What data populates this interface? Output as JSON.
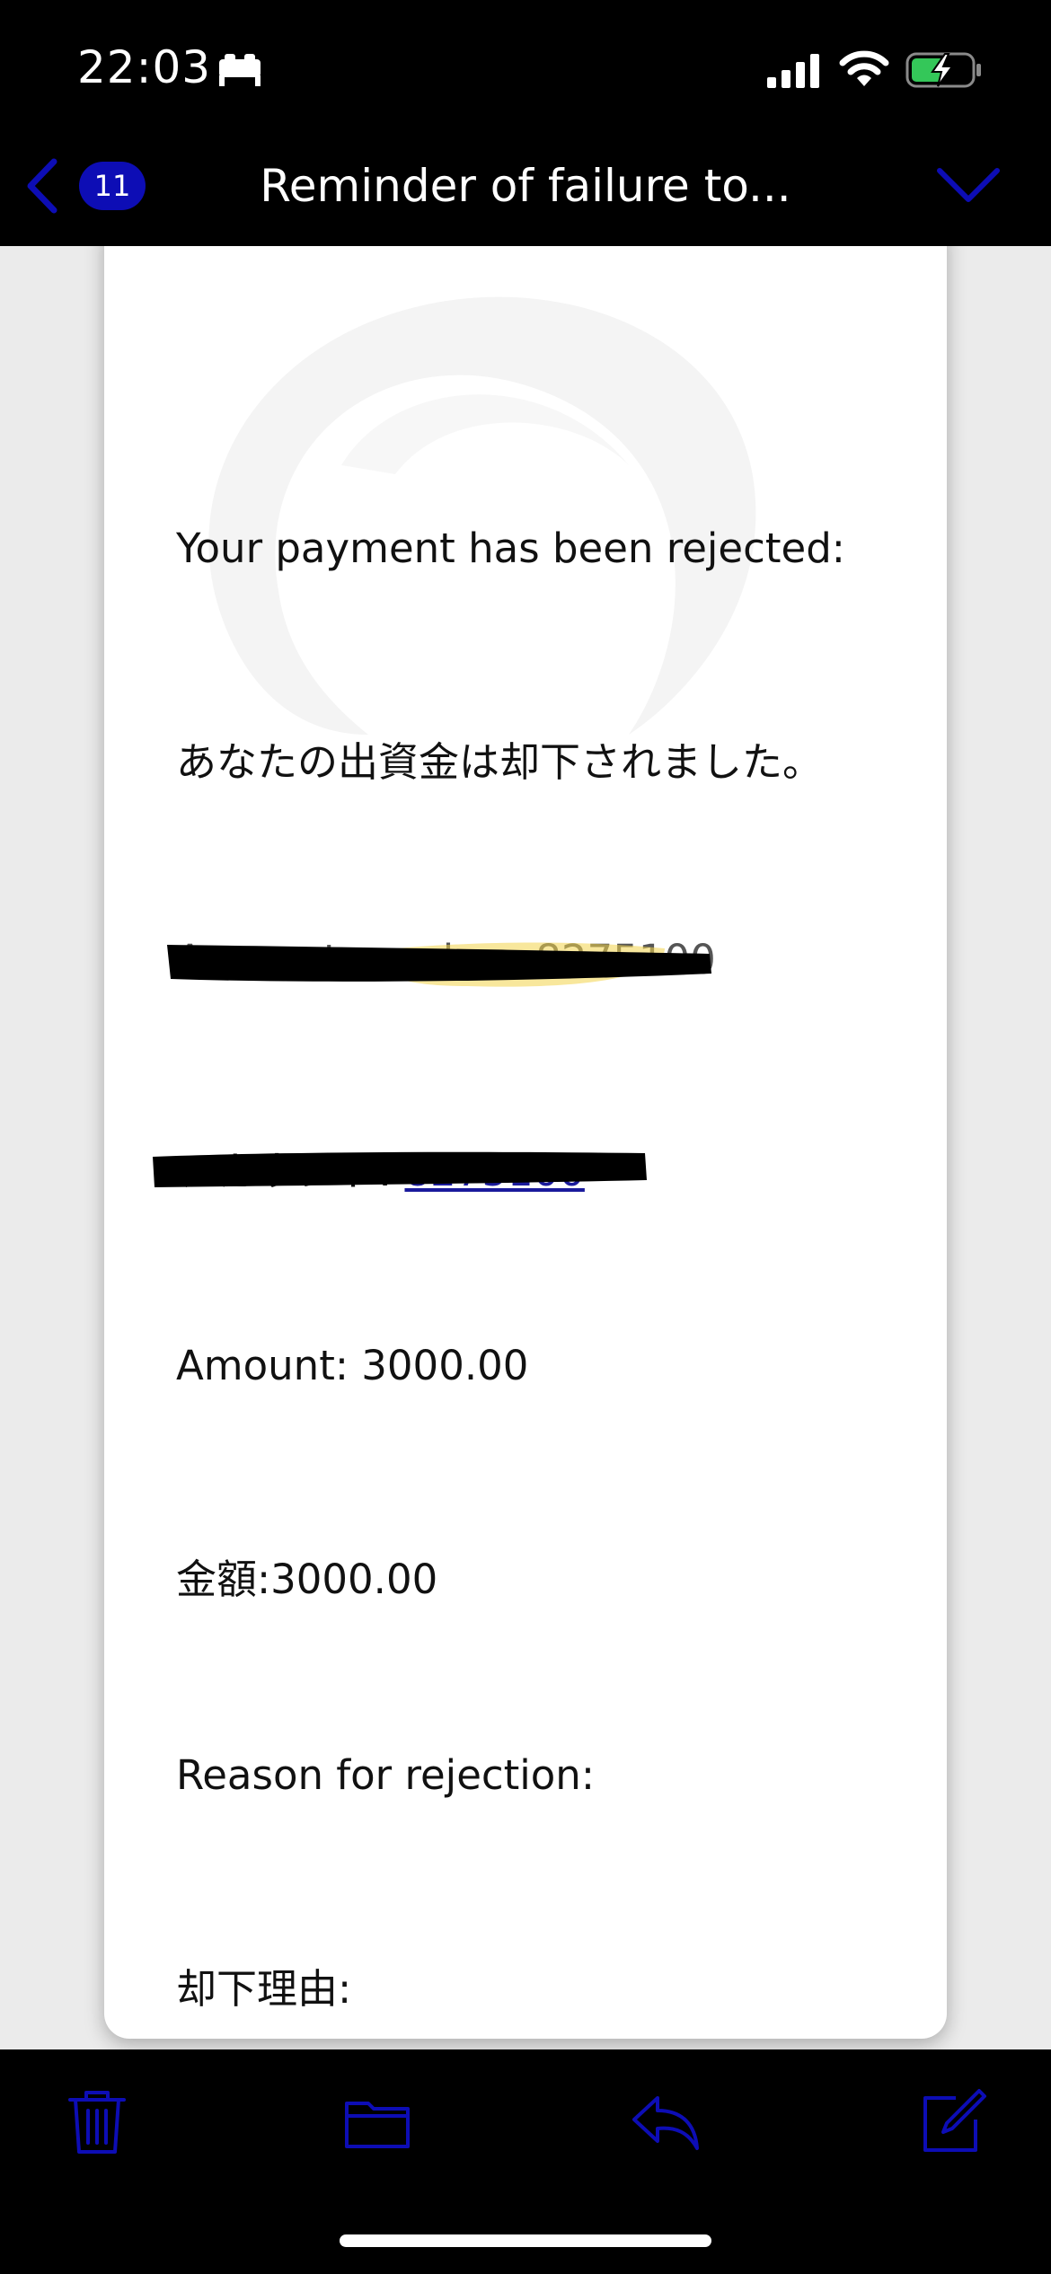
{
  "status_bar": {
    "time": "22:03",
    "icons": [
      "sleep-focus-icon",
      "cellular-signal-icon",
      "wifi-icon",
      "battery-charging-icon"
    ]
  },
  "nav": {
    "back_icon": "chevron-left-icon",
    "unread_count": "11",
    "title": "Reminder of failure to...",
    "next_icon": "chevron-down-icon"
  },
  "mail": {
    "line_rejected_en": "Your payment has been rejected:",
    "line_rejected_ja": "あなたの出資金は却下されました。",
    "line_account_en": "Account number: 8275100",
    "line_account_ja_label": "アカウント: ",
    "line_account_ja_link": "8275100",
    "line_amount_en": "Amount: 3000.00",
    "line_amount_ja": "金額:3000.00",
    "line_reason_en": "Reason for rejection:",
    "line_reason_ja": "却下理由:",
    "missing_image_glyph": "?"
  },
  "toolbar": {
    "icons": [
      "trash-icon",
      "folder-icon",
      "reply-icon",
      "compose-icon"
    ]
  },
  "colors": {
    "accent": "#0d0db5",
    "status_bg": "#000000",
    "battery_fill": "#34c759"
  }
}
